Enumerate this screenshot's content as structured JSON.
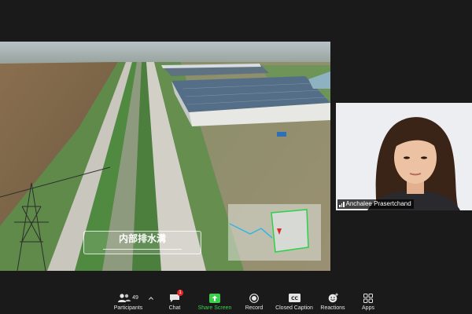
{
  "shared_screen": {
    "overlay_label": "内部排水溝"
  },
  "video": {
    "participant_name": "Anchalee Prasertchand"
  },
  "toolbar": {
    "participants_label": "Participants",
    "participants_count": "49",
    "chat_label": "Chat",
    "chat_badge": "1",
    "share_label": "Share Screen",
    "record_label": "Record",
    "cc_label": "Closed Caption",
    "reactions_label": "Reactions",
    "apps_label": "Apps"
  },
  "colors": {
    "share_accent": "#3ccf4e",
    "badge": "#e02828",
    "background": "#1a1a1a"
  }
}
